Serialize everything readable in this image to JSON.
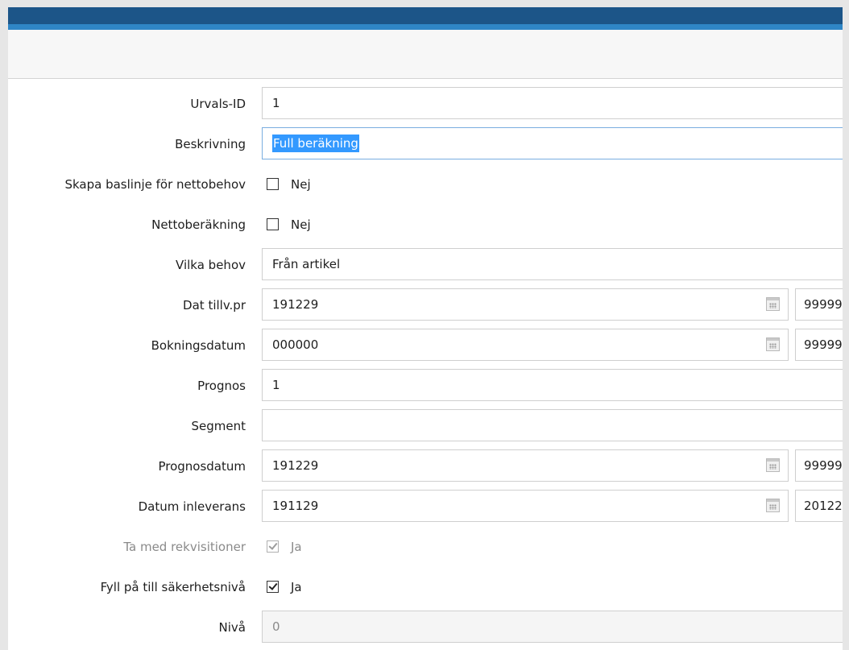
{
  "form": {
    "urvals_id": {
      "label": "Urvals-ID",
      "value": "1"
    },
    "beskrivning": {
      "label": "Beskrivning",
      "value": "Full beräkning"
    },
    "skapa_baslinje": {
      "label": "Skapa baslinje för nettobehov",
      "checked": false,
      "state_label": "Nej"
    },
    "nettoberakning": {
      "label": "Nettoberäkning",
      "checked": false,
      "state_label": "Nej"
    },
    "vilka_behov": {
      "label": "Vilka behov",
      "value": "Från artikel"
    },
    "dat_tillv_pr": {
      "label": "Dat tillv.pr",
      "from": "191229",
      "to": "99999"
    },
    "bokningsdatum": {
      "label": "Bokningsdatum",
      "from": "000000",
      "to": "99999"
    },
    "prognos": {
      "label": "Prognos",
      "value": "1"
    },
    "segment": {
      "label": "Segment",
      "value": ""
    },
    "prognosdatum": {
      "label": "Prognosdatum",
      "from": "191229",
      "to": "99999"
    },
    "datum_inleverans": {
      "label": "Datum inleverans",
      "from": "191129",
      "to": "20122"
    },
    "ta_med_rekvisitioner": {
      "label": "Ta med rekvisitioner",
      "checked": true,
      "disabled": true,
      "state_label": "Ja"
    },
    "fyll_pa": {
      "label": "Fyll på till säkerhetsnivå",
      "checked": true,
      "state_label": "Ja"
    },
    "niva": {
      "label": "Nivå",
      "value": "0",
      "disabled": true
    }
  },
  "icons": {
    "calendar": "calendar-icon"
  },
  "colors": {
    "header": "#1c5588",
    "accent": "#2f86c6",
    "selection": "#3399ff"
  }
}
